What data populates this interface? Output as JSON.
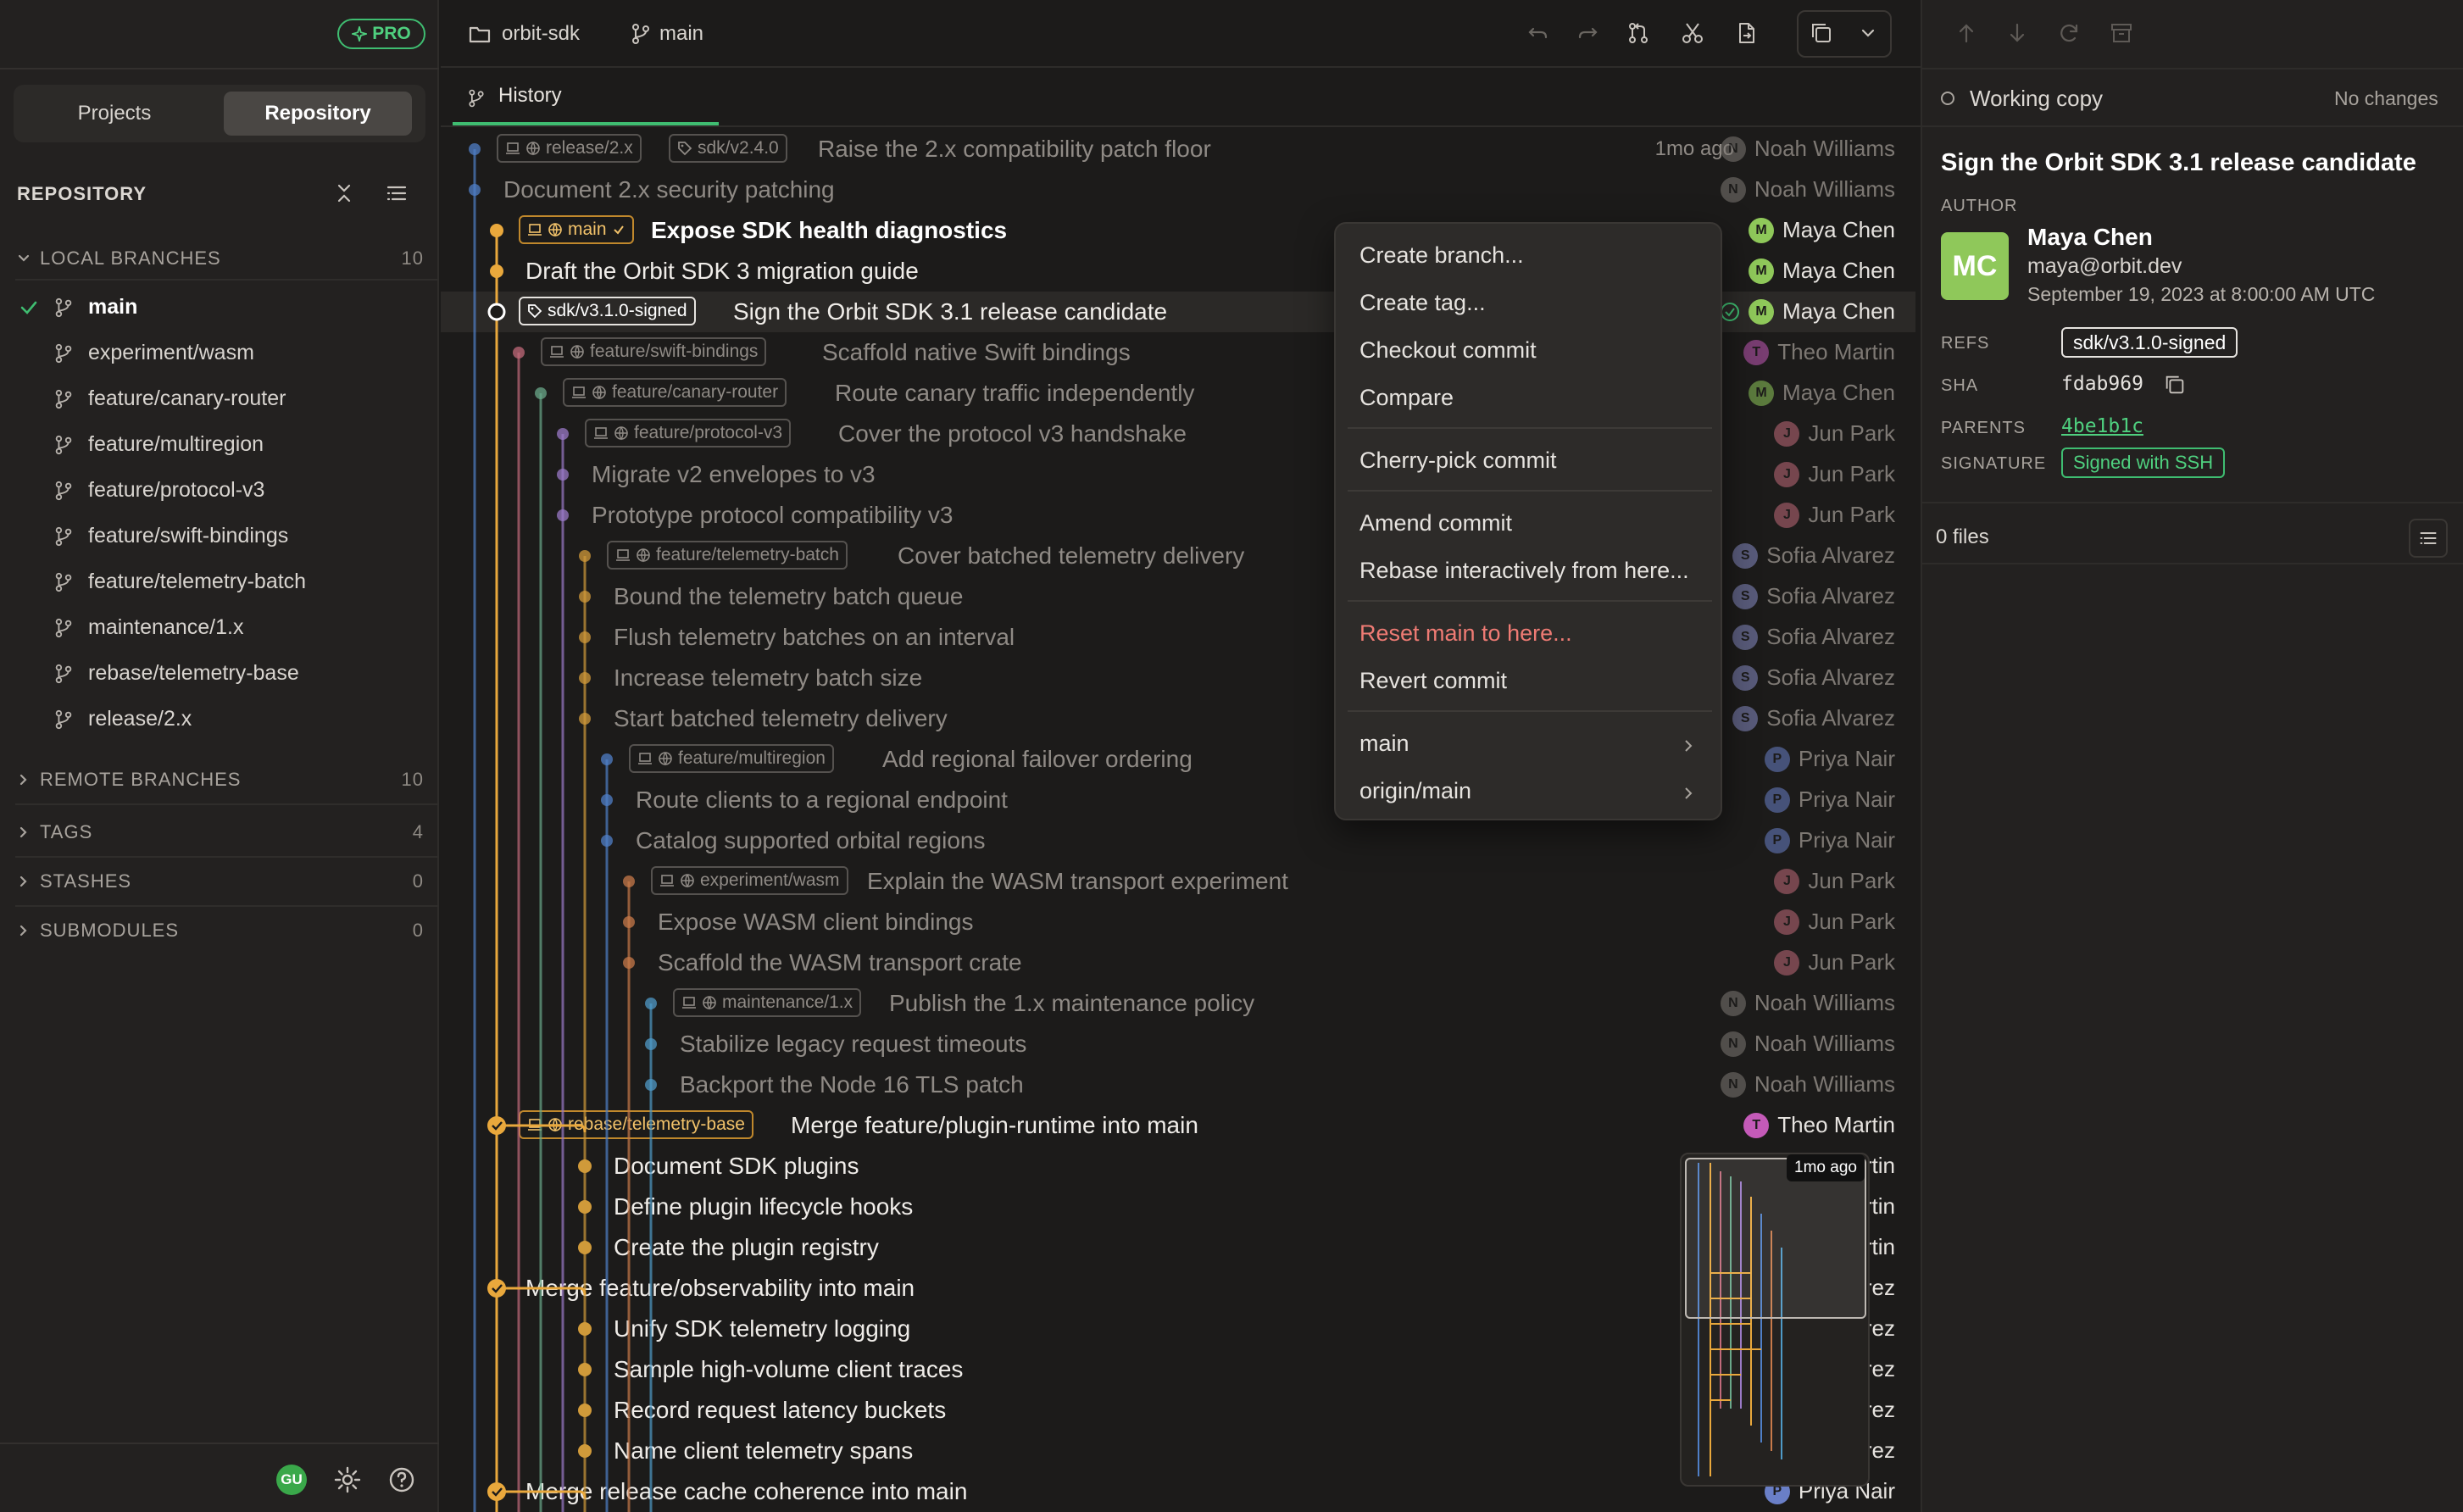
{
  "app": {
    "pro_badge": "PRO"
  },
  "sidebar": {
    "segments": [
      {
        "label": "Projects"
      },
      {
        "label": "Repository"
      }
    ],
    "repo_title": "REPOSITORY",
    "local_branches": {
      "label": "LOCAL BRANCHES",
      "count": "10",
      "items": [
        {
          "name": "main",
          "active": true
        },
        {
          "name": "experiment/wasm"
        },
        {
          "name": "feature/canary-router"
        },
        {
          "name": "feature/multiregion"
        },
        {
          "name": "feature/protocol-v3"
        },
        {
          "name": "feature/swift-bindings"
        },
        {
          "name": "feature/telemetry-batch"
        },
        {
          "name": "maintenance/1.x"
        },
        {
          "name": "rebase/telemetry-base"
        },
        {
          "name": "release/2.x"
        }
      ]
    },
    "sections": [
      {
        "label": "REMOTE BRANCHES",
        "count": "10"
      },
      {
        "label": "TAGS",
        "count": "4"
      },
      {
        "label": "STASHES",
        "count": "0"
      },
      {
        "label": "SUBMODULES",
        "count": "0"
      }
    ],
    "user_initials": "GU"
  },
  "breadcrumb": {
    "repo": "orbit-sdk",
    "branch": "main"
  },
  "tabs": [
    {
      "label": "History"
    }
  ],
  "commits": [
    {
      "msg": "Raise the 2.x compatibility patch floor",
      "author": "Noah Williams",
      "init": "N",
      "lane": 0,
      "style": "dim",
      "refs": [
        {
          "text": "release/2.x",
          "kind": "branch"
        },
        {
          "text": "sdk/v2.4.0",
          "kind": "tag"
        }
      ],
      "time": "1mo ago"
    },
    {
      "msg": "Document 2.x security patching",
      "author": "Noah Williams",
      "init": "N",
      "lane": 0,
      "style": "dim"
    },
    {
      "msg": "Expose SDK health diagnostics",
      "author": "Maya Chen",
      "init": "M",
      "lane": 1,
      "style": "bold",
      "refs": [
        {
          "text": "main",
          "kind": "head"
        }
      ]
    },
    {
      "msg": "Draft the Orbit SDK 3 migration guide",
      "author": "Maya Chen",
      "init": "M",
      "lane": 1,
      "style": "bright"
    },
    {
      "msg": "Sign the Orbit SDK 3.1 release candidate",
      "author": "Maya Chen",
      "init": "M",
      "lane": 1,
      "style": "bright",
      "selected": true,
      "verified": true,
      "refs": [
        {
          "text": "sdk/v3.1.0-signed",
          "kind": "tagwhite"
        }
      ]
    },
    {
      "msg": "Scaffold native Swift bindings",
      "author": "Theo Martin",
      "init": "T",
      "lane": 2,
      "style": "dim",
      "refs": [
        {
          "text": "feature/swift-bindings",
          "kind": "branch"
        }
      ]
    },
    {
      "msg": "Route canary traffic independently",
      "author": "Maya Chen",
      "init": "M",
      "lane": 3,
      "style": "dim",
      "refs": [
        {
          "text": "feature/canary-router",
          "kind": "branch"
        }
      ]
    },
    {
      "msg": "Cover the protocol v3 handshake",
      "author": "Jun Park",
      "init": "J",
      "lane": 4,
      "style": "dim",
      "refs": [
        {
          "text": "feature/protocol-v3",
          "kind": "branch"
        }
      ]
    },
    {
      "msg": "Migrate v2 envelopes to v3",
      "author": "Jun Park",
      "init": "J",
      "lane": 4,
      "style": "dim"
    },
    {
      "msg": "Prototype protocol compatibility v3",
      "author": "Jun Park",
      "init": "J",
      "lane": 4,
      "style": "dim"
    },
    {
      "msg": "Cover batched telemetry delivery",
      "author": "Sofia Alvarez",
      "init": "S",
      "lane": 5,
      "style": "dim",
      "refs": [
        {
          "text": "feature/telemetry-batch",
          "kind": "branch"
        }
      ]
    },
    {
      "msg": "Bound the telemetry batch queue",
      "author": "Sofia Alvarez",
      "init": "S",
      "lane": 5,
      "style": "dim"
    },
    {
      "msg": "Flush telemetry batches on an interval",
      "author": "Sofia Alvarez",
      "init": "S",
      "lane": 5,
      "style": "dim"
    },
    {
      "msg": "Increase telemetry batch size",
      "author": "Sofia Alvarez",
      "init": "S",
      "lane": 5,
      "style": "dim"
    },
    {
      "msg": "Start batched telemetry delivery",
      "author": "Sofia Alvarez",
      "init": "S",
      "lane": 5,
      "style": "dim"
    },
    {
      "msg": "Add regional failover ordering",
      "author": "Priya Nair",
      "init": "P",
      "lane": 6,
      "style": "dim",
      "refs": [
        {
          "text": "feature/multiregion",
          "kind": "branch"
        }
      ]
    },
    {
      "msg": "Route clients to a regional endpoint",
      "author": "Priya Nair",
      "init": "P",
      "lane": 6,
      "style": "dim"
    },
    {
      "msg": "Catalog supported orbital regions",
      "author": "Priya Nair",
      "init": "P",
      "lane": 6,
      "style": "dim"
    },
    {
      "msg": "Explain the WASM transport experiment",
      "author": "Jun Park",
      "init": "J",
      "lane": 7,
      "style": "dim",
      "refs": [
        {
          "text": "experiment/wasm",
          "kind": "branch"
        }
      ]
    },
    {
      "msg": "Expose WASM client bindings",
      "author": "Jun Park",
      "init": "J",
      "lane": 7,
      "style": "dim"
    },
    {
      "msg": "Scaffold the WASM transport crate",
      "author": "Jun Park",
      "init": "J",
      "lane": 7,
      "style": "dim"
    },
    {
      "msg": "Publish the 1.x maintenance policy",
      "author": "Noah Williams",
      "init": "N",
      "lane": 8,
      "style": "dim",
      "refs": [
        {
          "text": "maintenance/1.x",
          "kind": "branch"
        }
      ]
    },
    {
      "msg": "Stabilize legacy request timeouts",
      "author": "Noah Williams",
      "init": "N",
      "lane": 8,
      "style": "dim"
    },
    {
      "msg": "Backport the Node 16 TLS patch",
      "author": "Noah Williams",
      "init": "N",
      "lane": 8,
      "style": "dim"
    },
    {
      "msg": "Merge feature/plugin-runtime into main",
      "author": "Theo Martin",
      "init": "T",
      "lane": 1,
      "style": "bright",
      "merge": true,
      "refs": [
        {
          "text": "rebase/telemetry-base",
          "kind": "orange"
        }
      ]
    },
    {
      "msg": "Document SDK plugins",
      "author": "Theo Martin",
      "init": "T",
      "lane": 5,
      "style": "bright"
    },
    {
      "msg": "Define plugin lifecycle hooks",
      "author": "Theo Martin",
      "init": "T",
      "lane": 5,
      "style": "bright"
    },
    {
      "msg": "Create the plugin registry",
      "author": "Theo Martin",
      "init": "T",
      "lane": 5,
      "style": "bright"
    },
    {
      "msg": "Merge feature/observability into main",
      "author": "Sofia Alvarez",
      "init": "S",
      "lane": 1,
      "style": "bright",
      "merge": true
    },
    {
      "msg": "Unify SDK telemetry logging",
      "author": "Sofia Alvarez",
      "init": "S",
      "lane": 5,
      "style": "bright"
    },
    {
      "msg": "Sample high-volume client traces",
      "author": "Sofia Alvarez",
      "init": "S",
      "lane": 5,
      "style": "bright"
    },
    {
      "msg": "Record request latency buckets",
      "author": "Sofia Alvarez",
      "init": "S",
      "lane": 5,
      "style": "bright"
    },
    {
      "msg": "Name client telemetry spans",
      "author": "Sofia Alvarez",
      "init": "S",
      "lane": 5,
      "style": "bright"
    },
    {
      "msg": "Merge release cache coherence into main",
      "author": "Priya Nair",
      "init": "P",
      "lane": 1,
      "style": "bright",
      "merge": true
    }
  ],
  "context_menu": {
    "items": [
      {
        "label": "Create branch..."
      },
      {
        "label": "Create tag..."
      },
      {
        "label": "Checkout commit"
      },
      {
        "label": "Compare",
        "sep_after": true
      },
      {
        "label": "Cherry-pick commit",
        "sep_after": true
      },
      {
        "label": "Amend commit"
      },
      {
        "label": "Rebase interactively from here...",
        "sep_after": true
      },
      {
        "label": "Reset main to here...",
        "danger": true
      },
      {
        "label": "Revert commit",
        "sep_after": true
      },
      {
        "label": "main",
        "submenu": true
      },
      {
        "label": "origin/main",
        "submenu": true
      }
    ]
  },
  "minimap": {
    "tooltip": "1mo ago"
  },
  "details": {
    "working_copy": "Working copy",
    "no_changes": "No changes",
    "title": "Sign the Orbit SDK 3.1 release candidate",
    "author_label": "AUTHOR",
    "author_initials": "MC",
    "author_name": "Maya Chen",
    "author_email": "maya@orbit.dev",
    "date": "September 19, 2023 at 8:00:00 AM UTC",
    "refs_label": "REFS",
    "refs": "sdk/v3.1.0-signed",
    "sha_label": "SHA",
    "sha": "fdab969",
    "parents_label": "PARENTS",
    "parents": "4be1b1c",
    "signature_label": "SIGNATURE",
    "signature": "Signed with SSH",
    "files": "0 files"
  },
  "colors": {
    "accent": "#3fbd71",
    "main_lane": "#e9a83c",
    "danger": "#ef7b74"
  }
}
